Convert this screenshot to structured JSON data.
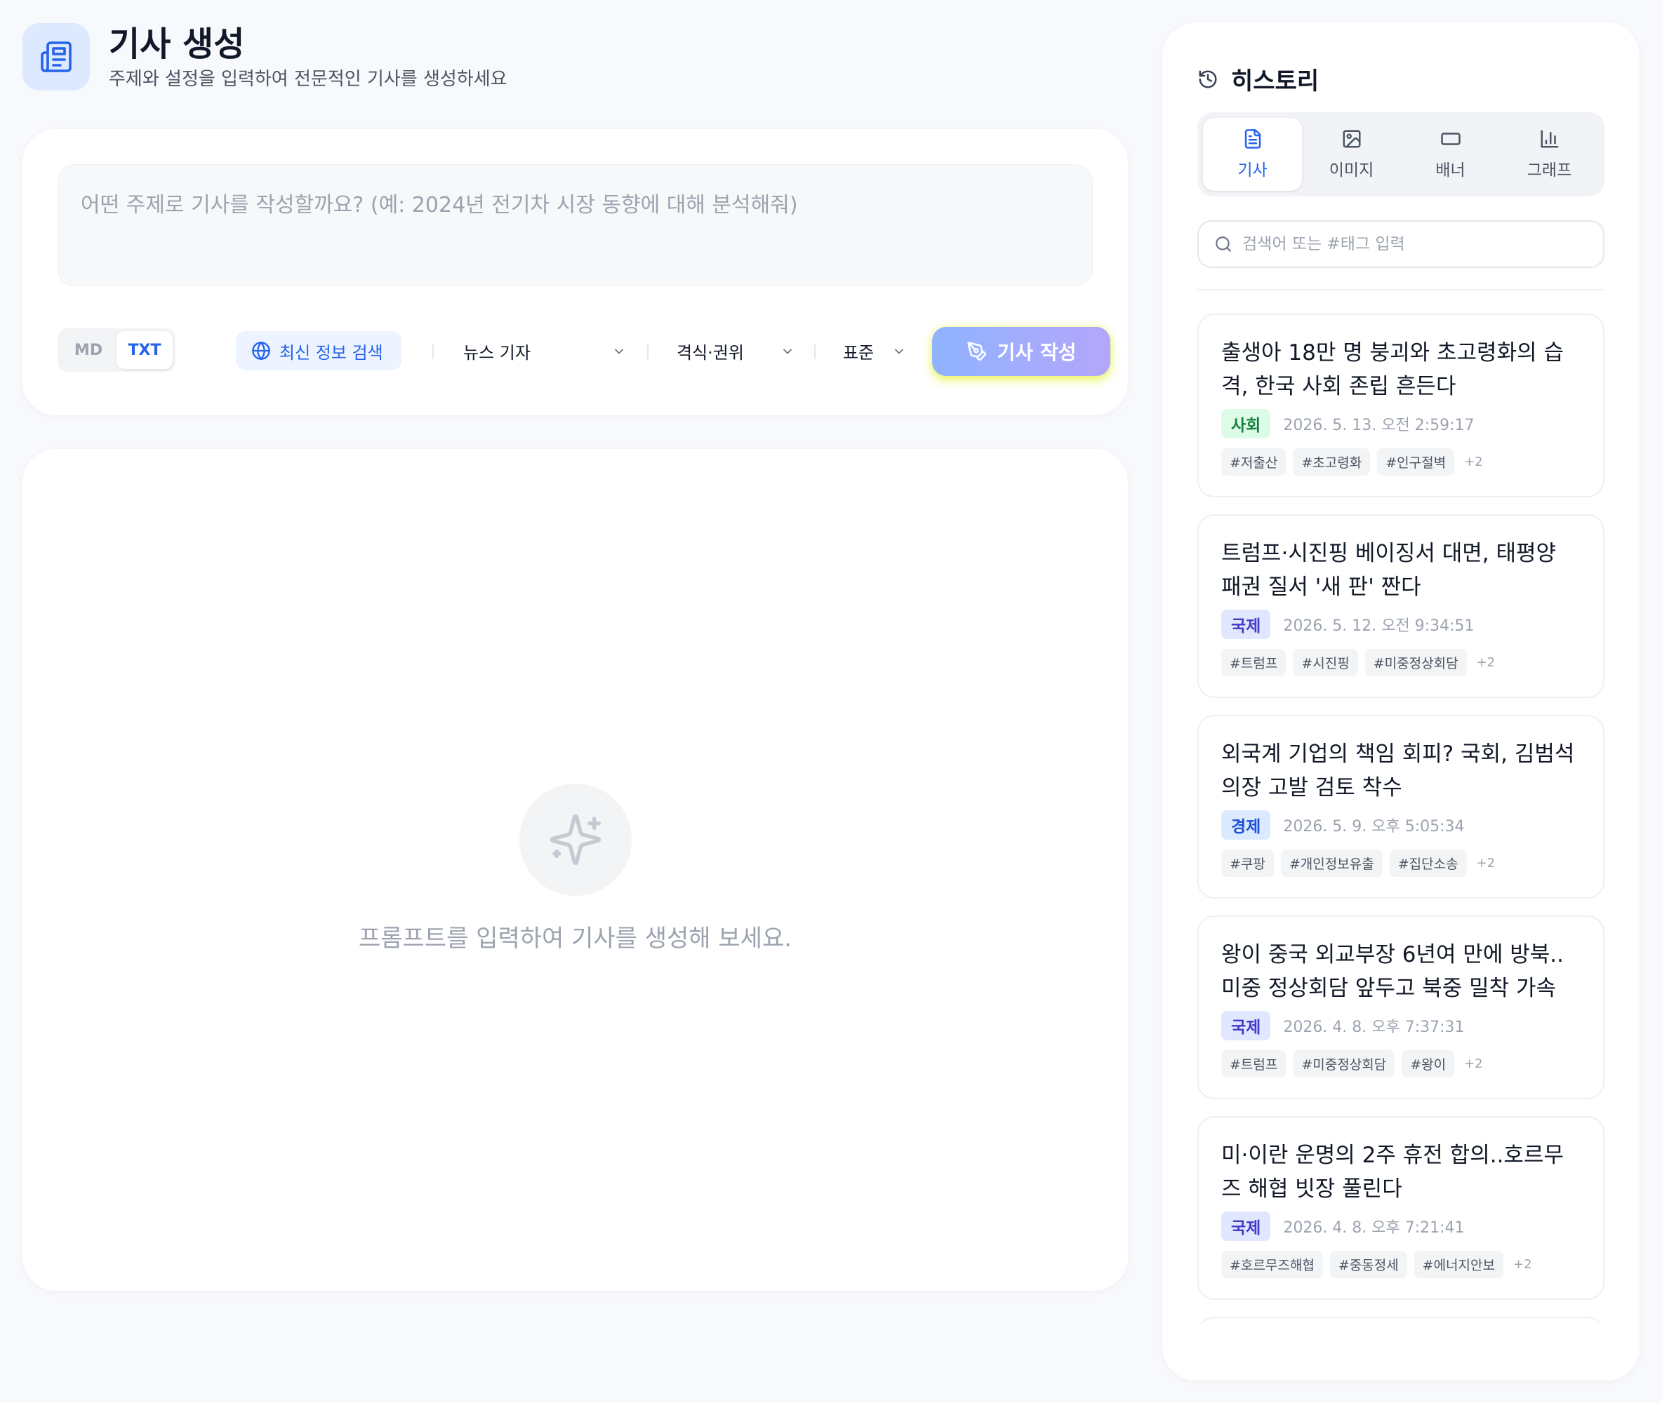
{
  "header": {
    "title": "기사 생성",
    "subtitle": "주제와 설정을 입력하여 전문적인 기사를 생성하세요"
  },
  "prompt": {
    "placeholder": "어떤 주제로 기사를 작성할까요? (예: 2024년 전기차 시장 동향에 대해 분석해줘)",
    "value": ""
  },
  "toolbar": {
    "format_options": [
      "MD",
      "TXT"
    ],
    "format_selected": "TXT",
    "search_label": "최신 정보 검색",
    "persona_value": "뉴스 기자",
    "tone_value": "격식·권위",
    "length_value": "표준",
    "generate_label": "기사 작성"
  },
  "empty_state": {
    "message": "프롬프트를 입력하여 기사를 생성해 보세요."
  },
  "history": {
    "title": "히스토리",
    "tabs": [
      {
        "label": "기사",
        "icon": "document-icon",
        "active": true
      },
      {
        "label": "이미지",
        "icon": "image-icon",
        "active": false
      },
      {
        "label": "배너",
        "icon": "banner-icon",
        "active": false
      },
      {
        "label": "그래프",
        "icon": "bar-chart-icon",
        "active": false
      }
    ],
    "search_placeholder": "검색어 또는 #태그 입력",
    "items": [
      {
        "title": "출생아 18만 명 붕괴와 초고령화의 습격, 한국 사회 존립 흔든다",
        "category": "사회",
        "date": "2026. 5. 13. 오전 2:59:17",
        "tags": [
          "#저출산",
          "#초고령화",
          "#인구절벽"
        ],
        "more": "+2"
      },
      {
        "title": "트럼프·시진핑 베이징서 대면, 태평양 패권 질서 '새 판' 짠다",
        "category": "국제",
        "date": "2026. 5. 12. 오전 9:34:51",
        "tags": [
          "#트럼프",
          "#시진핑",
          "#미중정상회담"
        ],
        "more": "+2"
      },
      {
        "title": "외국계 기업의 책임 회피? 국회, 김범석 의장 고발 검토 착수",
        "category": "경제",
        "date": "2026. 5. 9. 오후 5:05:34",
        "tags": [
          "#쿠팡",
          "#개인정보유출",
          "#집단소송"
        ],
        "more": "+2"
      },
      {
        "title": "왕이 중국 외교부장 6년여 만에 방북.. 미중 정상회담 앞두고 북중 밀착 가속",
        "category": "국제",
        "date": "2026. 4. 8. 오후 7:37:31",
        "tags": [
          "#트럼프",
          "#미중정상회담",
          "#왕이"
        ],
        "more": "+2"
      },
      {
        "title": "미·이란 운명의 2주 휴전 합의..호르무즈 해협 빗장 풀린다",
        "category": "국제",
        "date": "2026. 4. 8. 오후 7:21:41",
        "tags": [
          "#호르무즈해협",
          "#중동정세",
          "#에너지안보"
        ],
        "more": "+2"
      }
    ]
  },
  "colors": {
    "accent": "#2563eb",
    "cat_social_bg": "#dcfce7",
    "cat_intl_bg": "#e0e7ff",
    "cat_econ_bg": "#dbeafe"
  }
}
